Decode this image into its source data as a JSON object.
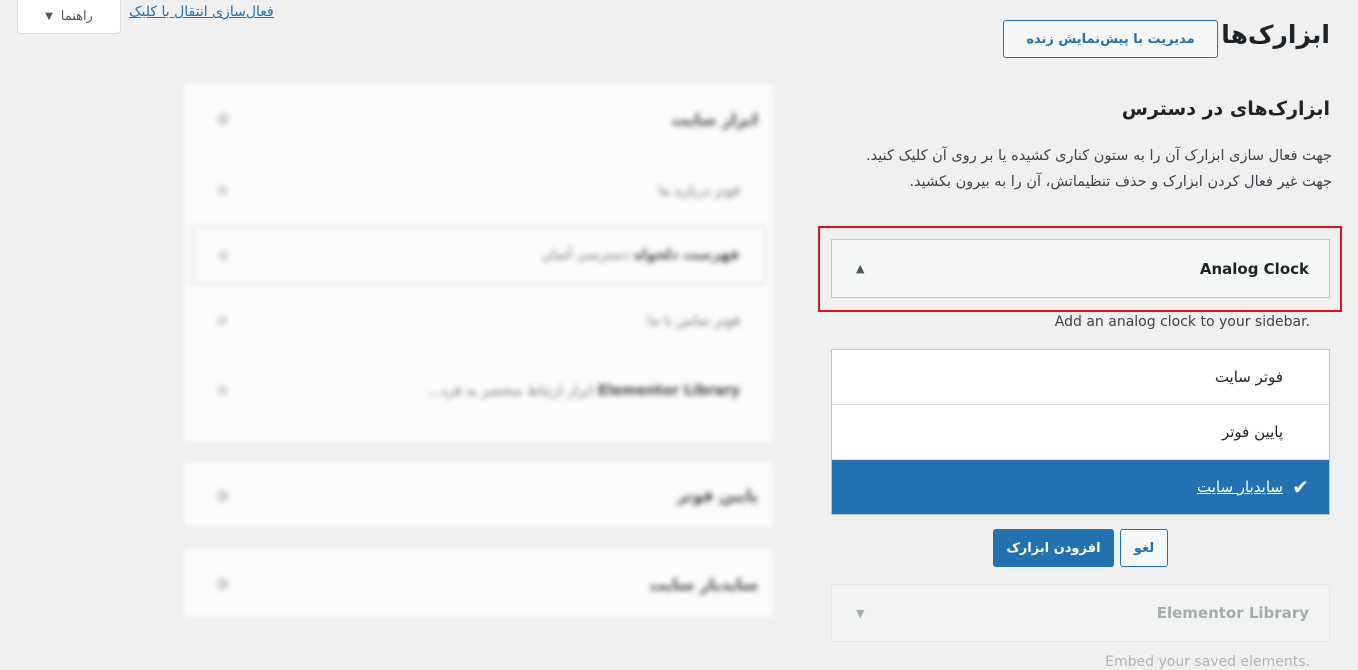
{
  "top": {
    "help_label": "راهنما",
    "click_activation_link": "فعال‌سازی انتقال با کلیک"
  },
  "header": {
    "title": "ابزارک‌ها",
    "manage_button": "مدیریت با پیش‌نمایش زنده"
  },
  "available": {
    "title": "ابزارک‌های در دسترس",
    "description": "جهت فعال سازی ابزارک آن را به ستون کناری کشیده یا بر روی آن کلیک کنید. جهت غیر فعال کردن ابزارک و حذف تنظیماتش، آن را به بیرون بکشید.",
    "open_widget": {
      "title": "Analog Clock",
      "description": "Add an analog clock to your sidebar.",
      "sidebars": [
        {
          "label": "فوتر سایت",
          "selected": false
        },
        {
          "label": "پایین فوتر",
          "selected": false
        },
        {
          "label": "سایدبار سایت",
          "selected": true
        }
      ],
      "cancel_button": "لغو",
      "add_button": "افزودن ابزارک"
    },
    "next_widget": {
      "title": "Elementor Library",
      "description": "Embed your saved elements."
    }
  },
  "widget_areas": [
    {
      "title": "ابزار سایت",
      "widgets": [
        {
          "name": "",
          "detail": "فوتر درباره ما"
        },
        {
          "name": "فهرست دلخواه",
          "detail": "دسترسی آسان"
        },
        {
          "name": "",
          "detail": "فوتر تماس با ما"
        },
        {
          "name": "Elementor Library",
          "detail": "ابزار ارتباط منحصر به فرد..."
        }
      ]
    },
    {
      "title": "پایین فوتر",
      "widgets": []
    },
    {
      "title": "سایدبار سایت",
      "widgets": []
    }
  ],
  "colors": {
    "accent": "#2271b1",
    "highlight": "#e0141b",
    "background": "#f0f0f1"
  }
}
